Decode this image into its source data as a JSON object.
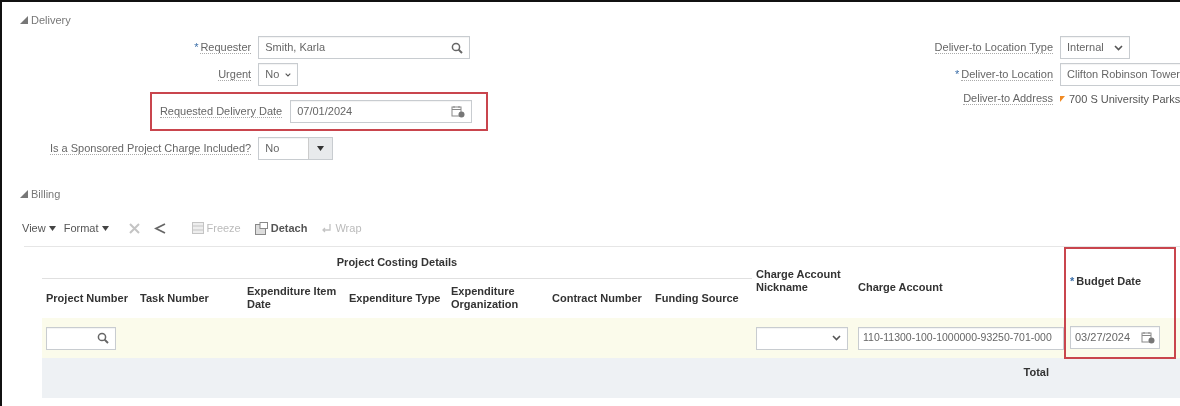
{
  "delivery": {
    "title": "Delivery",
    "expanded": true,
    "left_fields": [
      {
        "label": "Requester",
        "required_mark": "*",
        "kind": "search",
        "value": "Smith, Karla",
        "highlighted": false
      },
      {
        "label": "Urgent",
        "kind": "select",
        "value": "No",
        "highlighted": false
      },
      {
        "label": "Requested Delivery Date",
        "kind": "date",
        "value": "07/01/2024",
        "highlighted": true
      },
      {
        "label": "Is a Sponsored Project Charge Included?",
        "kind": "dropdown",
        "value": "No",
        "highlighted": false
      }
    ],
    "right_fields": [
      {
        "label": "Deliver-to Location Type",
        "kind": "select",
        "value": "Internal"
      },
      {
        "label": "Deliver-to Location",
        "required_mark": "*",
        "kind": "text",
        "value": "Clifton Robinson Tower"
      },
      {
        "label": "Deliver-to Address",
        "kind": "readonly",
        "value": "700 S University Parks"
      }
    ]
  },
  "billing": {
    "title": "Billing",
    "expanded": true,
    "toolbar": [
      {
        "label": "View",
        "kind": "menu",
        "disabled": false
      },
      {
        "label": "Format",
        "kind": "menu",
        "disabled": false
      },
      {
        "kind": "delete",
        "disabled": true
      },
      {
        "kind": "share",
        "disabled": false
      },
      {
        "label": "Freeze",
        "kind": "freeze",
        "disabled": true
      },
      {
        "label": "Detach",
        "kind": "detach",
        "disabled": false
      },
      {
        "label": "Wrap",
        "kind": "wrap",
        "disabled": true
      }
    ],
    "table": {
      "group_header": "Project Costing Details",
      "columns": [
        {
          "label": "Project Number",
          "grouped": true,
          "highlighted": false
        },
        {
          "label": "Task Number",
          "grouped": true,
          "highlighted": false
        },
        {
          "label": "Expenditure Item Date",
          "grouped": true,
          "highlighted": false
        },
        {
          "label": "Expenditure Type",
          "grouped": true,
          "highlighted": false
        },
        {
          "label": "Expenditure Organization",
          "grouped": true,
          "highlighted": false
        },
        {
          "label": "Contract Number",
          "grouped": true,
          "highlighted": false
        },
        {
          "label": "Funding Source",
          "grouped": true,
          "highlighted": false
        },
        {
          "label": "Charge Account Nickname",
          "grouped": false,
          "highlighted": false
        },
        {
          "label": "Charge Account",
          "grouped": false,
          "highlighted": false
        },
        {
          "label": "Budget Date",
          "required_mark": "*",
          "grouped": false,
          "highlighted": true
        }
      ],
      "row": [
        {
          "kind": "search"
        },
        {
          "kind": "blank"
        },
        {
          "kind": "blank"
        },
        {
          "kind": "blank"
        },
        {
          "kind": "blank"
        },
        {
          "kind": "blank"
        },
        {
          "kind": "blank"
        },
        {
          "kind": "select"
        },
        {
          "kind": "text",
          "value": "110-11300-100-1000000-93250-701-000"
        },
        {
          "kind": "date",
          "value": "03/27/2024"
        }
      ],
      "total_label": "Total"
    }
  }
}
